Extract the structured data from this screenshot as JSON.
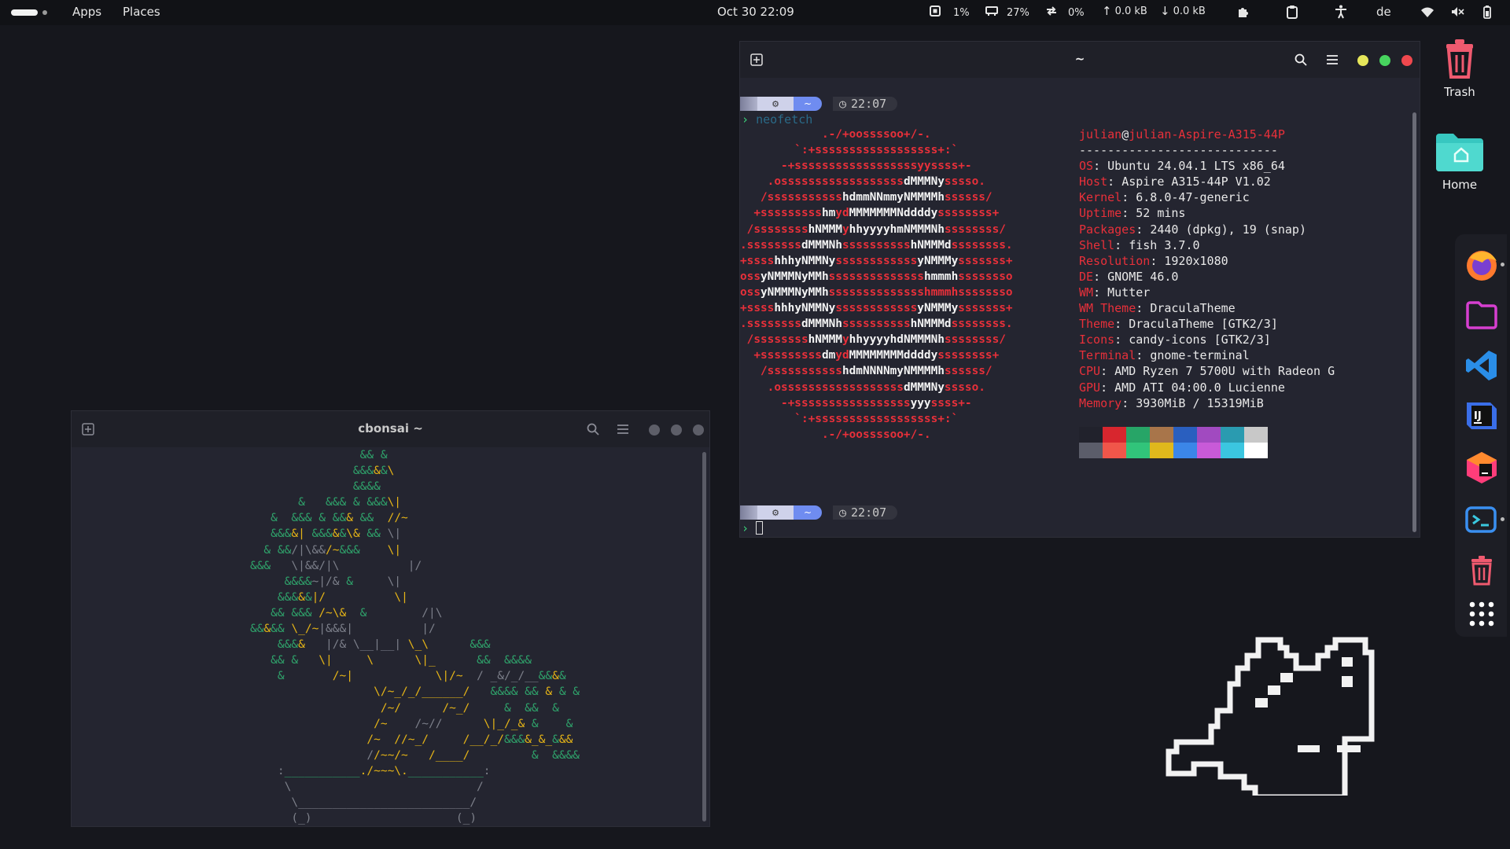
{
  "topbar": {
    "menu_apps": "Apps",
    "menu_places": "Places",
    "clock": "Oct 30  22:09",
    "cpu": "1%",
    "memory": "27%",
    "swap": "0%",
    "net_up": "0.0 kB",
    "net_down": "0.0 kB",
    "keyboard": "de"
  },
  "desktop": {
    "trash_label": "Trash",
    "home_label": "Home"
  },
  "dock": {
    "items": [
      "firefox-icon",
      "files-icon",
      "vscode-icon",
      "intellij-icon",
      "jetbrains-toolbox-icon",
      "terminal-icon",
      "trash-icon",
      "app-grid-icon"
    ]
  },
  "bonsai_window": {
    "title": "cbonsai ~"
  },
  "neofetch_window": {
    "title": "~",
    "prompt_time_1": "22:07",
    "prompt_time_2": "22:07",
    "command": "neofetch",
    "user": "julian",
    "host": "julian-Aspire-A315-44P",
    "separator": "----------------------------",
    "info": [
      {
        "key": "OS",
        "value": "Ubuntu 24.04.1 LTS x86_64"
      },
      {
        "key": "Host",
        "value": "Aspire A315-44P V1.02"
      },
      {
        "key": "Kernel",
        "value": "6.8.0-47-generic"
      },
      {
        "key": "Uptime",
        "value": "52 mins"
      },
      {
        "key": "Packages",
        "value": "2440 (dpkg), 19 (snap)"
      },
      {
        "key": "Shell",
        "value": "fish 3.7.0"
      },
      {
        "key": "Resolution",
        "value": "1920x1080"
      },
      {
        "key": "DE",
        "value": "GNOME 46.0"
      },
      {
        "key": "WM",
        "value": "Mutter"
      },
      {
        "key": "WM Theme",
        "value": "DraculaTheme"
      },
      {
        "key": "Theme",
        "value": "DraculaTheme [GTK2/3]"
      },
      {
        "key": "Icons",
        "value": "candy-icons [GTK2/3]"
      },
      {
        "key": "Terminal",
        "value": "gnome-terminal"
      },
      {
        "key": "CPU",
        "value": "AMD Ryzen 7 5700U with Radeon G"
      },
      {
        "key": "GPU",
        "value": "AMD ATI 04:00.0 Lucienne"
      },
      {
        "key": "Memory",
        "value": "3930MiB / 15319MiB"
      }
    ],
    "palette_top": [
      "#21222c",
      "#d8262e",
      "#27a567",
      "#a8754a",
      "#2a5fbf",
      "#a14ac0",
      "#2a9bb0",
      "#c8c8c8"
    ],
    "palette_bottom": [
      "#5b5d6a",
      "#f0564a",
      "#31c47a",
      "#e0b81c",
      "#3b86e8",
      "#c85ad8",
      "#3bc6e0",
      "#ffffff"
    ]
  }
}
